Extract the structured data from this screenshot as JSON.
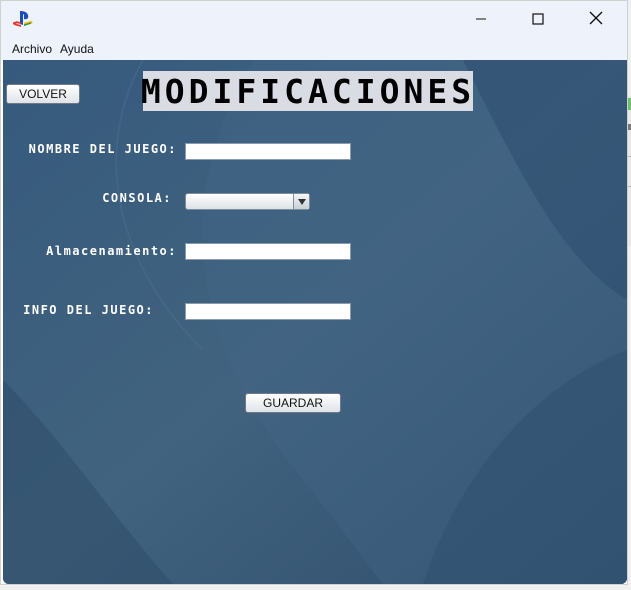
{
  "menu": {
    "items": [
      "Archivo",
      "Ayuda"
    ]
  },
  "window_controls": {
    "minimize": "minimize-icon",
    "maximize": "maximize-icon",
    "close": "close-icon"
  },
  "app_icon": "playstation-logo-icon",
  "form": {
    "back_button": "VOLVER",
    "title": "MODIFICACIONES",
    "fields": {
      "nombre": {
        "label": "NOMBRE DEL JUEGO:",
        "value": ""
      },
      "consola": {
        "label": "CONSOLA:",
        "value": ""
      },
      "almacenamiento": {
        "label": "Almacenamiento:",
        "value": ""
      },
      "info": {
        "label": "INFO DEL JUEGO:",
        "value": ""
      }
    },
    "save_button": "GUARDAR"
  },
  "colors": {
    "panel_background": "#3d5f80",
    "title_background": "#d9dde3",
    "label_text": "#ffffff"
  }
}
